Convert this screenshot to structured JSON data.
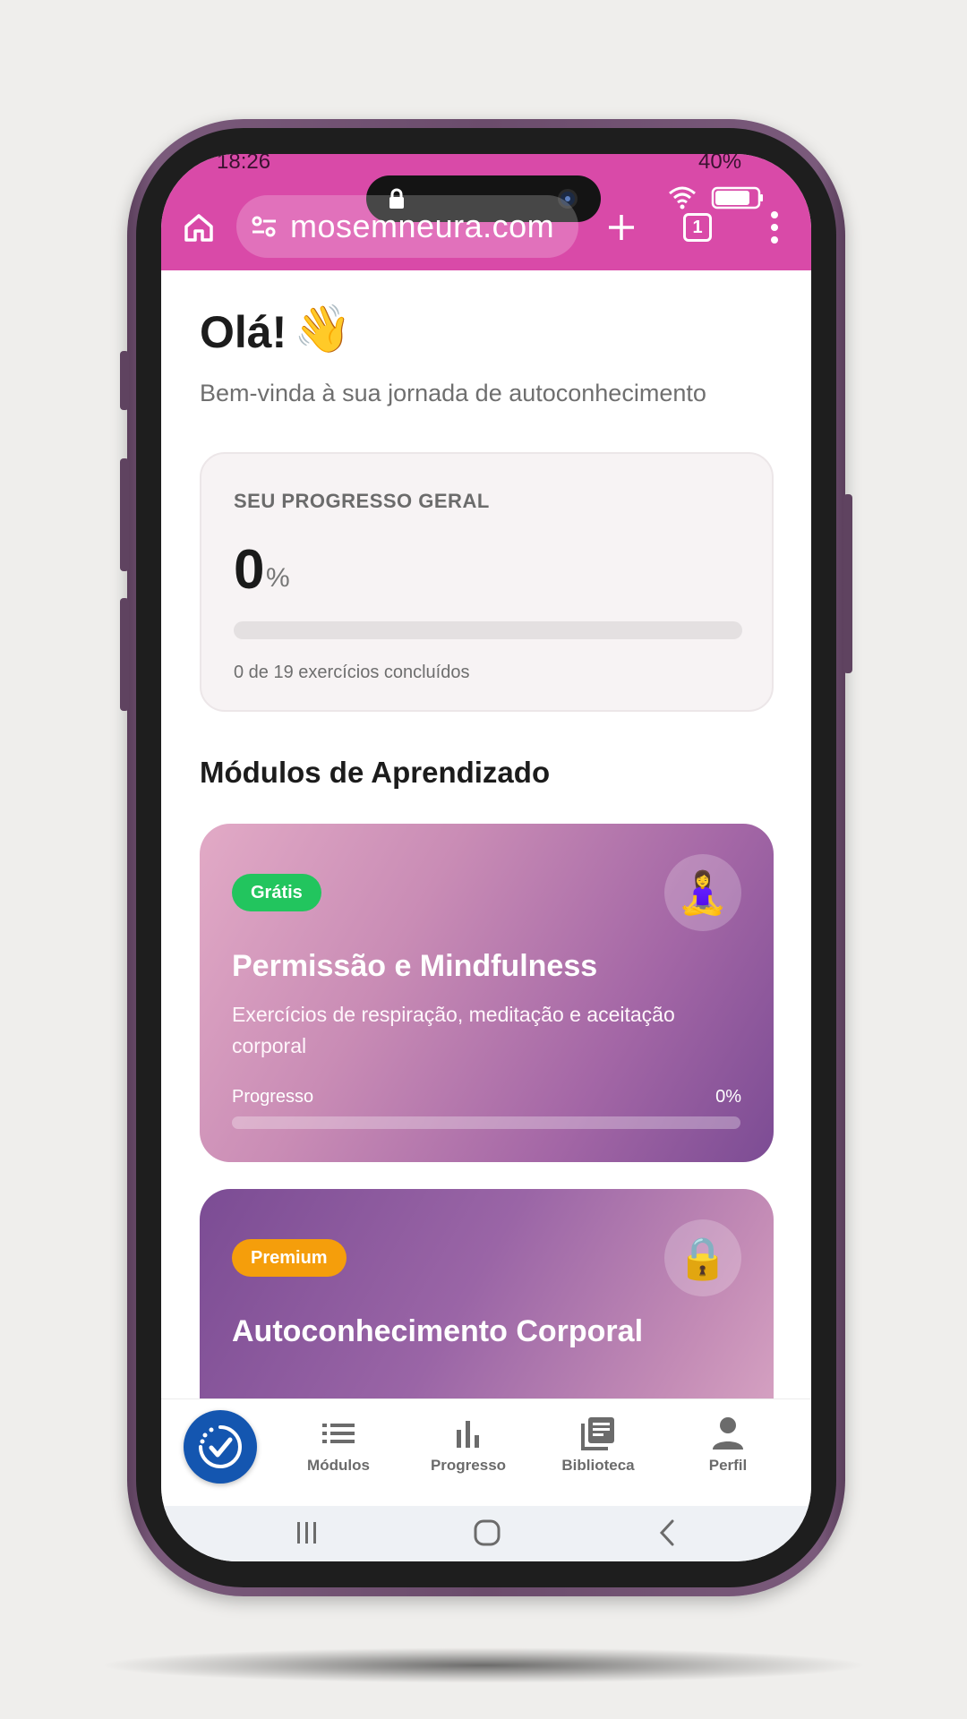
{
  "status_bar": {
    "time": "18:26",
    "battery": "40%"
  },
  "browser": {
    "url": "mosemneura.com",
    "tab_count": "1"
  },
  "greeting": {
    "title": "Olá!",
    "emoji": "👋",
    "subtitle": "Bem-vinda à sua jornada de autoconhecimento"
  },
  "overall_progress": {
    "label": "SEU PROGRESSO GERAL",
    "value": "0",
    "unit": "%",
    "fraction": 0,
    "caption": "0 de 19 exercícios concluídos"
  },
  "modules_section": {
    "title": "Módulos de Aprendizado"
  },
  "modules": [
    {
      "badge": "Grátis",
      "emoji": "🧘‍♀️",
      "title": "Permissão e Mindfulness",
      "description": "Exercícios de respiração, meditação e aceitação corporal",
      "progress_label": "Progresso",
      "progress_value": "0%",
      "progress_fraction": 0
    },
    {
      "badge": "Premium",
      "emoji": "🔒",
      "title": "Autoconhecimento Corporal"
    }
  ],
  "bottom_nav": {
    "items": [
      {
        "label": "Módulos",
        "icon": "list-icon"
      },
      {
        "label": "Progresso",
        "icon": "bar-chart-icon"
      },
      {
        "label": "Biblioteca",
        "icon": "library-icon"
      },
      {
        "label": "Perfil",
        "icon": "person-icon"
      }
    ],
    "fab_icon": "clock-check-icon"
  },
  "colors": {
    "browser_bar": "#d94aa8",
    "free_badge": "#22c55e",
    "premium_badge": "#f59e0b",
    "fab": "#1456b0"
  }
}
